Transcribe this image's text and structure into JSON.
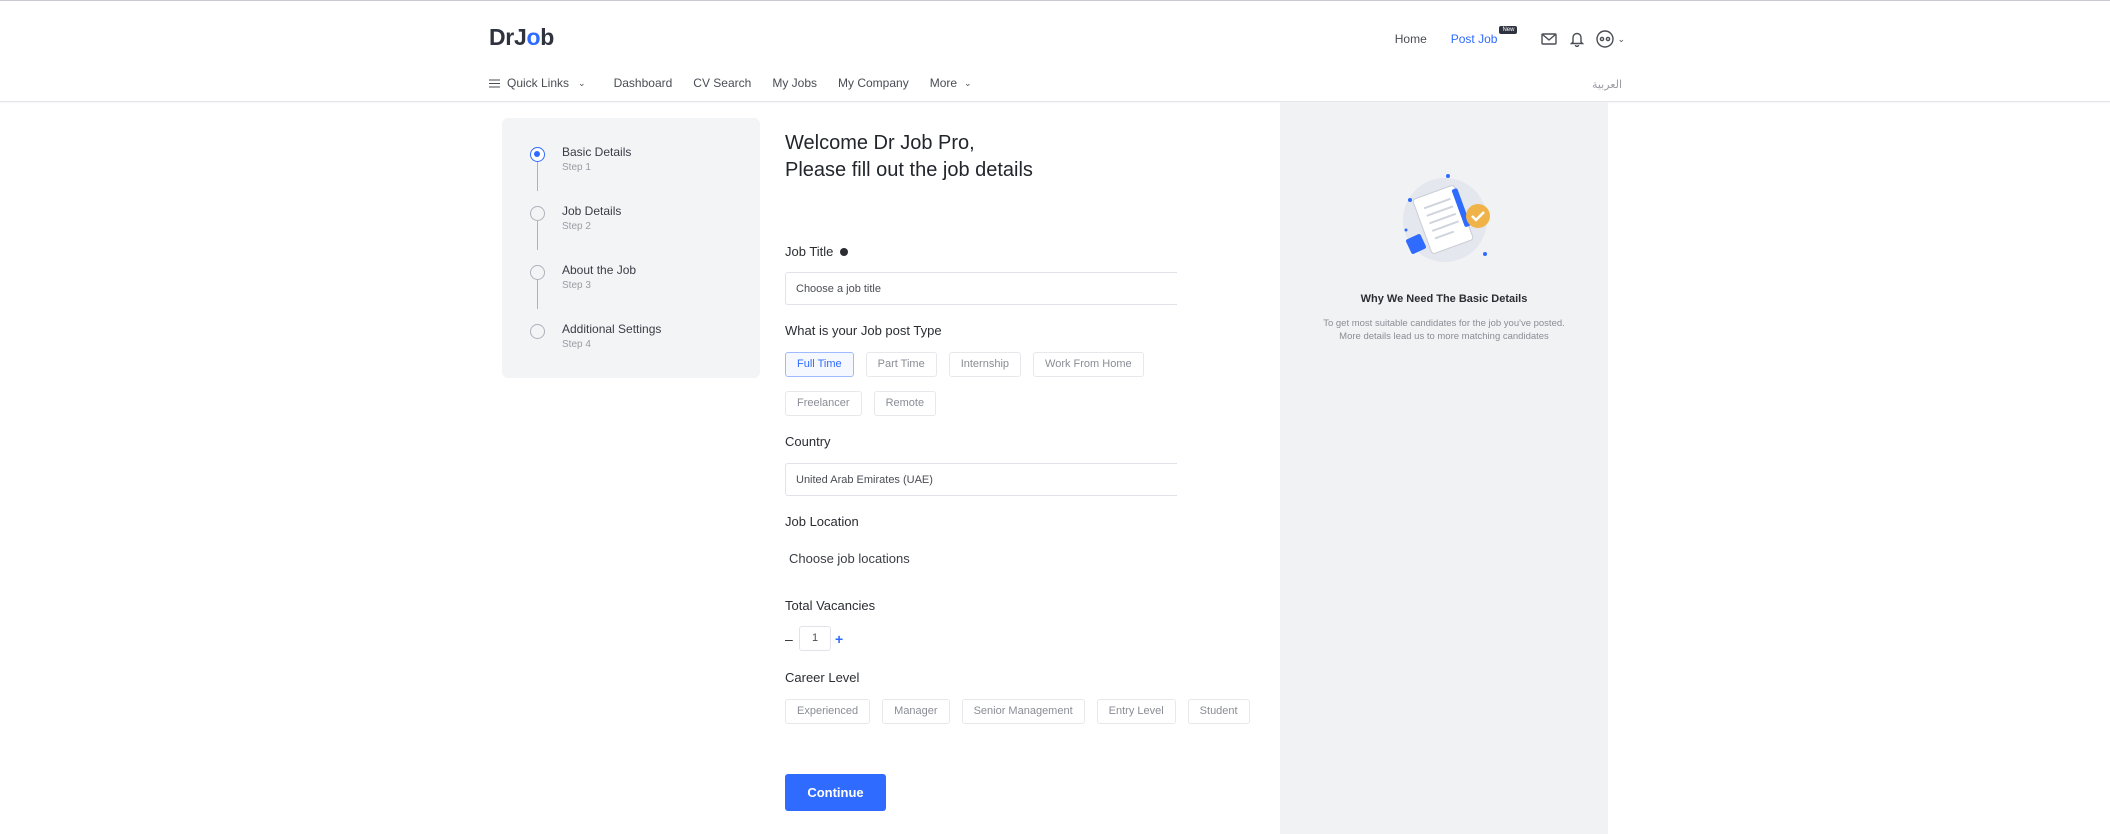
{
  "header": {
    "logo": {
      "prefix": "DrJ",
      "o": "o",
      "suffix": "b"
    },
    "nav": {
      "home": "Home",
      "post_job": "Post Job",
      "new_badge": "New"
    },
    "icons": [
      "mail-icon",
      "bell-icon",
      "profile-icon"
    ],
    "language": "العربية"
  },
  "subnav": {
    "quick_links": "Quick Links",
    "items": [
      "Dashboard",
      "CV Search",
      "My Jobs",
      "My Company"
    ],
    "more": "More"
  },
  "steps": [
    {
      "label": "Basic Details",
      "sub": "Step 1",
      "active": true
    },
    {
      "label": "Job Details",
      "sub": "Step 2",
      "active": false
    },
    {
      "label": "About the Job",
      "sub": "Step 3",
      "active": false
    },
    {
      "label": "Additional Settings",
      "sub": "Step 4",
      "active": false
    }
  ],
  "form": {
    "welcome_line1": "Welcome Dr Job Pro,",
    "welcome_line2": "Please fill out the job details",
    "job_title_label": "Job Title",
    "job_title_placeholder": "Choose a job title",
    "post_type_label": "What is your Job post Type",
    "post_types": [
      "Full Time",
      "Part Time",
      "Internship",
      "Work From Home",
      "Freelancer",
      "Remote"
    ],
    "post_type_selected": "Full Time",
    "country_label": "Country",
    "country_value": "United Arab Emirates (UAE)",
    "location_label": "Job Location",
    "location_placeholder": "Choose job locations",
    "vacancies_label": "Total Vacancies",
    "vacancies_value": "1",
    "vacancies_minus": "–",
    "vacancies_plus": "+",
    "career_label": "Career Level",
    "career_levels": [
      "Experienced",
      "Manager",
      "Senior Management",
      "Entry Level",
      "Student"
    ],
    "continue_label": "Continue"
  },
  "info_panel": {
    "title": "Why We Need The Basic Details",
    "desc_line1": "To get most suitable candidates for the job you've posted.",
    "desc_line2": "More details lead us to more matching candidates"
  },
  "colors": {
    "accent": "#2f6bff",
    "panel_bg": "#f1f2f4",
    "text": "#2b2d33"
  }
}
